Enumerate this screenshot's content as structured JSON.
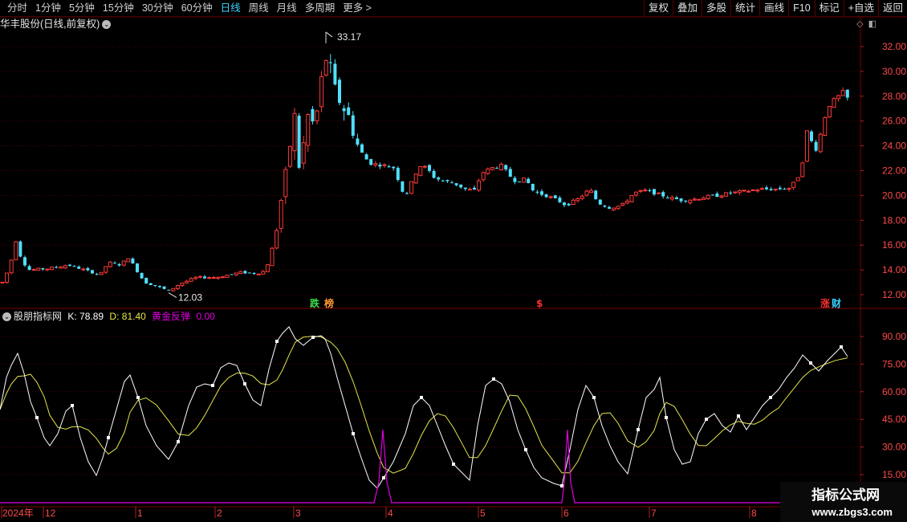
{
  "toolbar": {
    "periods": [
      "分时",
      "1分钟",
      "5分钟",
      "15分钟",
      "30分钟",
      "60分钟",
      "日线",
      "周线",
      "月线",
      "多周期",
      "更多 >"
    ],
    "active": "日线",
    "right_buttons": [
      "复权",
      "叠加",
      "多股",
      "统计",
      "画线",
      "F10",
      "标记",
      "+自选",
      "返回"
    ]
  },
  "main_panel": {
    "title": "华丰股份(日线,前复权)",
    "high_label": "33.17",
    "low_label": "12.03",
    "y_ticks": [
      "32.00",
      "30.00",
      "28.00",
      "26.00",
      "24.00",
      "22.00",
      "20.00",
      "18.00",
      "16.00",
      "14.00",
      "12.00"
    ],
    "markers": [
      {
        "text": "跌",
        "color": "#3be04a"
      },
      {
        "text": "榜",
        "color": "#ff9a30"
      },
      {
        "text": "$",
        "color": "#ff3030"
      },
      {
        "text": "涨",
        "color": "#ff3030"
      },
      {
        "text": "财",
        "color": "#3ad2ff"
      }
    ]
  },
  "indicator": {
    "name": "股朋指标网",
    "k_label": "K:",
    "k_value": "78.89",
    "d_label": "D:",
    "d_value": "81.40",
    "gold_label": "黄金反弹",
    "gold_value": "0.00",
    "y_ticks": [
      "90.00",
      "75.00",
      "60.00",
      "45.00",
      "30.00",
      "15.00"
    ]
  },
  "x_axis": {
    "labels": [
      "2024年",
      "12",
      "1",
      "2",
      "3",
      "4",
      "5",
      "6",
      "7",
      "8"
    ]
  },
  "watermark": {
    "line1": "指标公式网",
    "line2": "www.zbgs3.com"
  },
  "colors": {
    "up": "#ff3a3a",
    "down": "#4fe0ff",
    "grid": "#5a0000",
    "k_line": "#ffffff",
    "d_line": "#e6e64a",
    "gold": "#e000e0"
  }
}
